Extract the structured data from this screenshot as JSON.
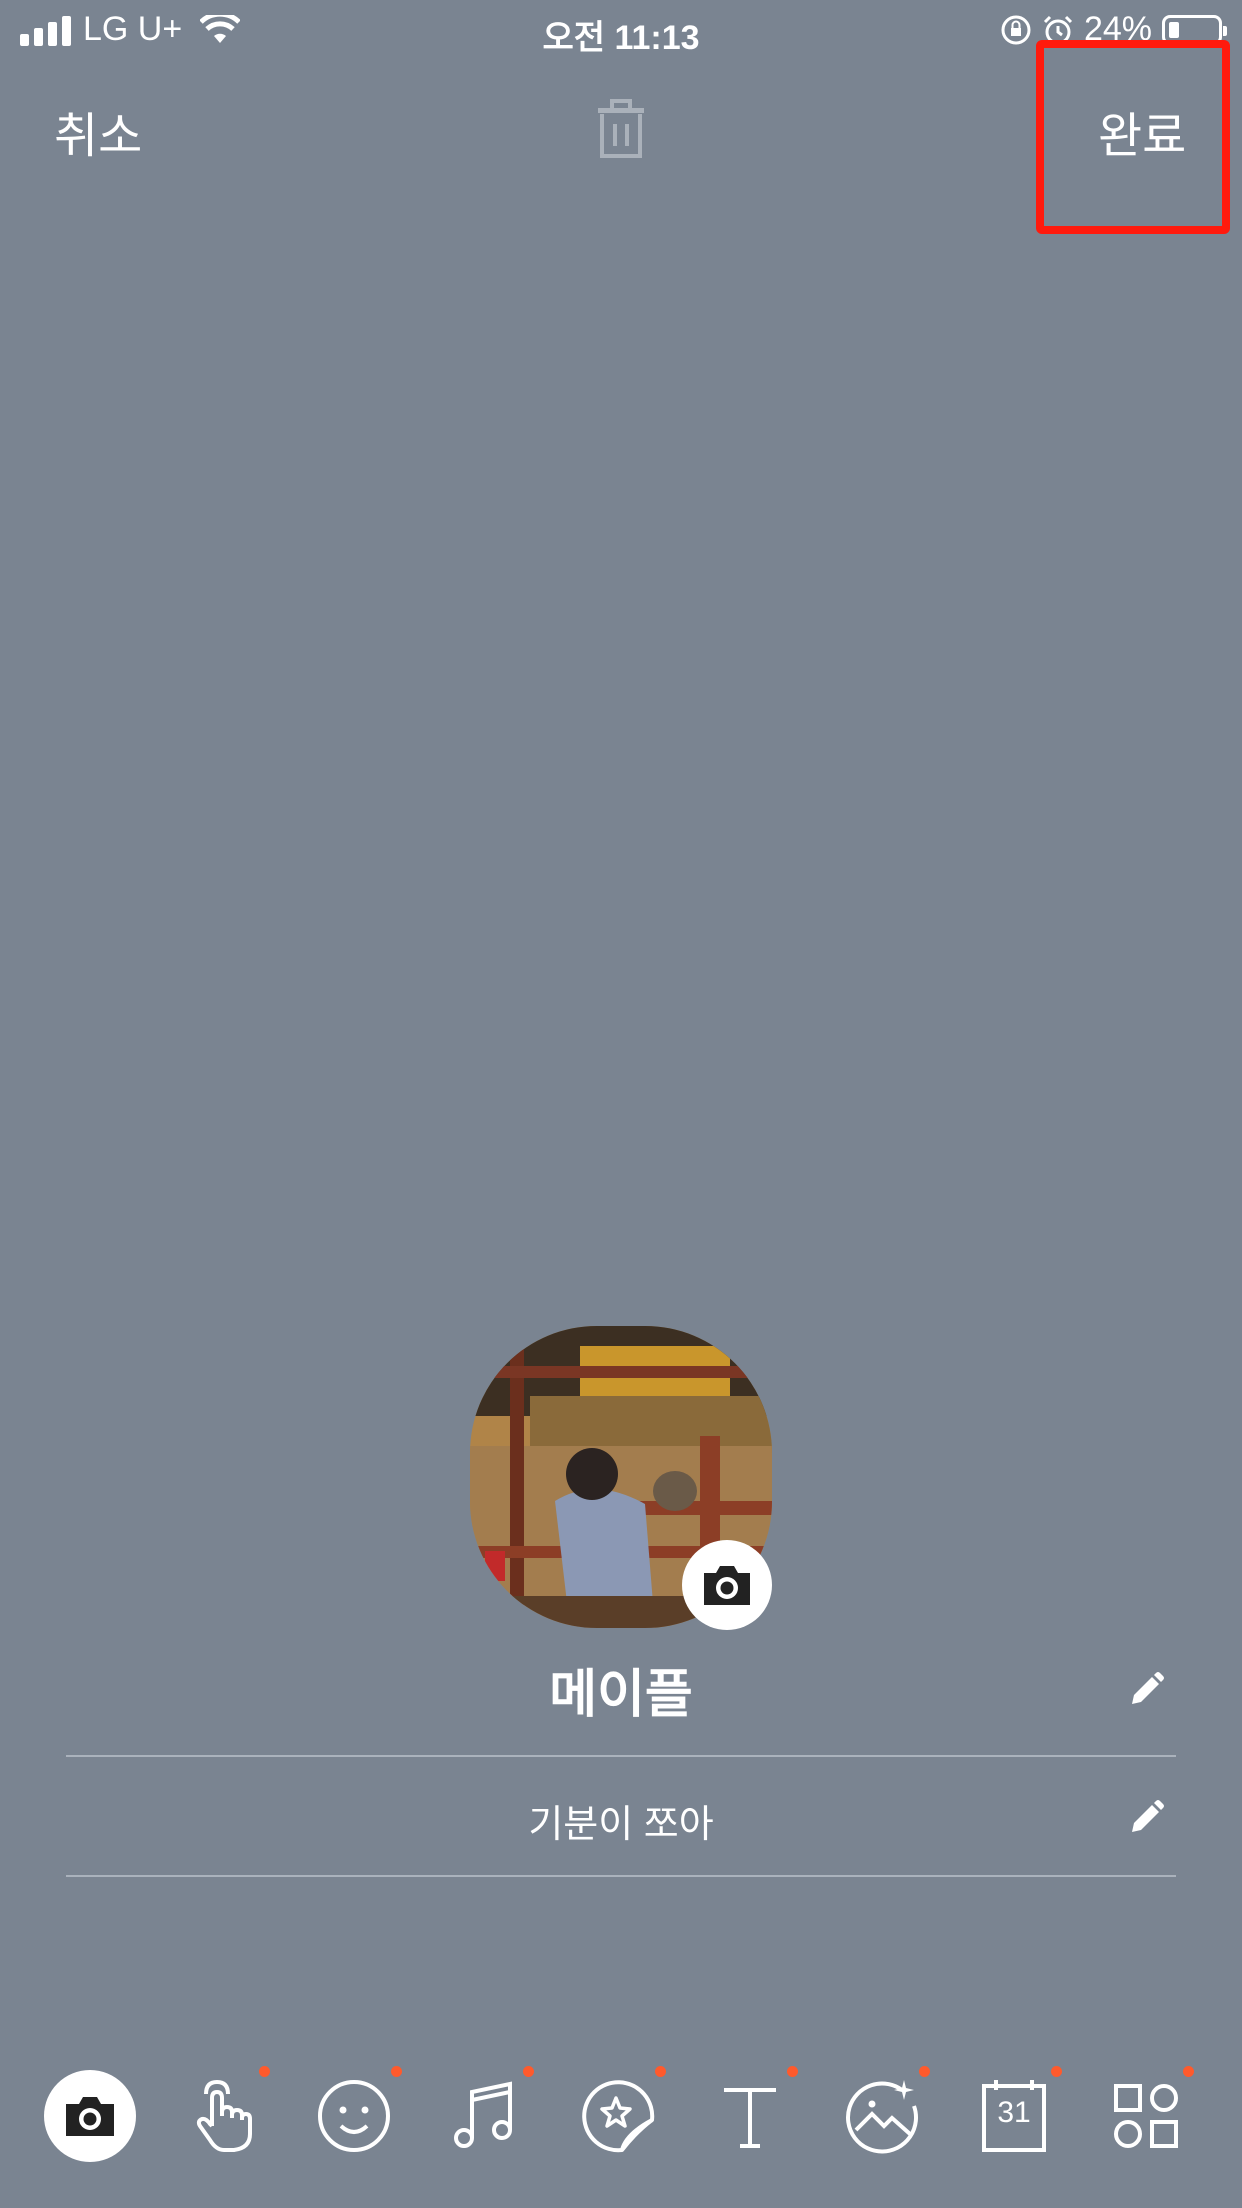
{
  "status_bar": {
    "carrier": "LG U+",
    "time": "오전 11:13",
    "battery": "24%"
  },
  "header": {
    "cancel_label": "취소",
    "done_label": "완료"
  },
  "profile": {
    "name": "메이플",
    "status_message": "기분이 쪼아"
  },
  "toolbar": {
    "tools": [
      "camera-icon",
      "hand-touch-icon",
      "smiley-icon",
      "music-icon",
      "sticker-icon",
      "text-icon",
      "image-effect-icon",
      "calendar-icon",
      "widgets-icon"
    ],
    "calendar_day": "31"
  },
  "colors": {
    "background": "#7a8491",
    "highlight": "#ff1a0d",
    "new_dot": "#ff5a2c"
  }
}
